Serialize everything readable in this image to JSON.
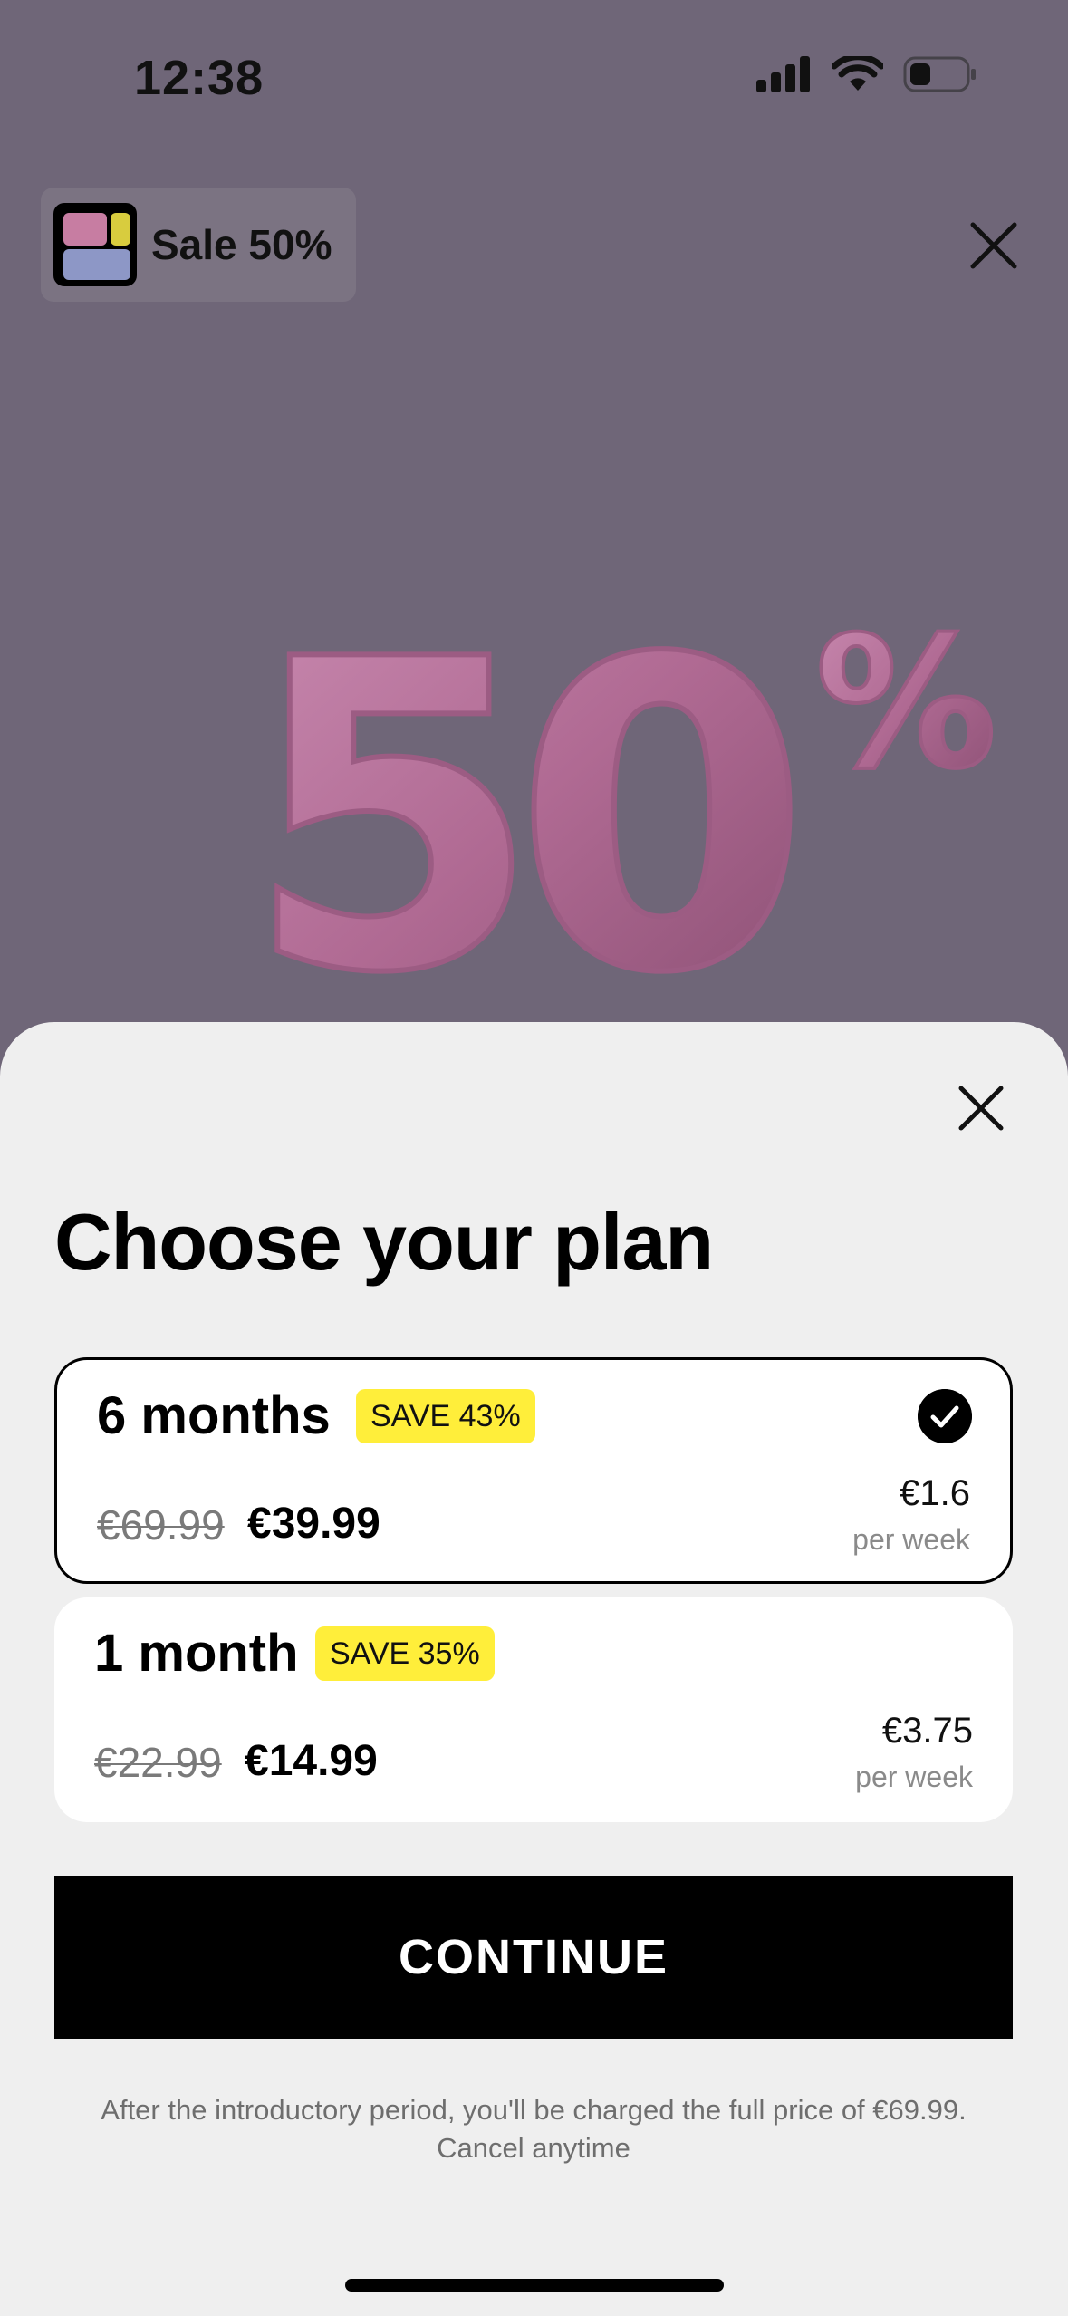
{
  "status_bar": {
    "time": "12:38"
  },
  "promo": {
    "badge_text": "Sale 50%",
    "hero_text": "50",
    "hero_percent": "%"
  },
  "sheet": {
    "title": "Choose your plan",
    "plans": [
      {
        "name": "6 months",
        "save": "SAVE 43%",
        "old_price": "€69.99",
        "new_price": "€39.99",
        "week_price": "€1.6",
        "per_week": "per week",
        "selected": true
      },
      {
        "name": "1 month",
        "save": "SAVE 35%",
        "old_price": "€22.99",
        "new_price": "€14.99",
        "week_price": "€3.75",
        "per_week": "per week",
        "selected": false
      }
    ],
    "continue_label": "CONTINUE",
    "disclaimer_line1": "After the introductory period, you'll be charged the full price of €69.99.",
    "disclaimer_line2": "Cancel anytime"
  },
  "colors": {
    "accent_yellow": "#ffee3a",
    "backdrop": "#6f6678",
    "hero_pink": "#b06a93",
    "sheet_bg": "#efefef"
  },
  "icons": [
    "cellular-signal-icon",
    "wifi-icon",
    "battery-icon",
    "close-icon",
    "checkmark-icon"
  ]
}
